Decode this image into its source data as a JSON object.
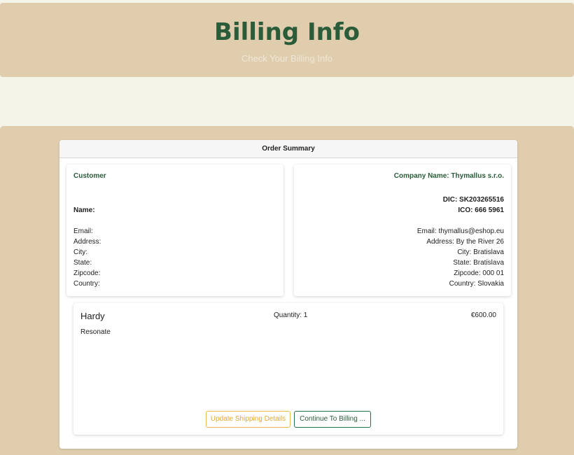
{
  "header": {
    "title": "Billing Info",
    "subtitle": "Check Your Billing Info"
  },
  "summary": {
    "title": "Order Summary",
    "customer": {
      "heading": "Customer",
      "name_label": "Name:",
      "email_label": "Email:",
      "address_label": "Address:",
      "city_label": "City:",
      "state_label": "State:",
      "zipcode_label": "Zipcode:",
      "country_label": "Country:"
    },
    "company": {
      "heading": "Company Name: Thymallus s.r.o.",
      "dic": "DIC: SK203265516",
      "ico": "ICO: 666 5961",
      "email": "Email: thymallus@eshop.eu",
      "address": "Address: By the River 26",
      "city": "City: Bratislava",
      "state": "State: Bratislava",
      "zipcode": "Zipcode: 000 01",
      "country": "Country: Slovakia"
    },
    "item": {
      "name": "Hardy",
      "description": "Resonate",
      "quantity": "Quantity: 1",
      "price": "€600.00"
    },
    "buttons": {
      "update": "Update Shipping Details",
      "continue": "Continue To Billing ..."
    }
  },
  "colors": {
    "accent_green": "#2a5c3a",
    "tan": "#dfcdae",
    "cream": "#f5f4e9",
    "warning_yellow": "#e0a82e"
  }
}
